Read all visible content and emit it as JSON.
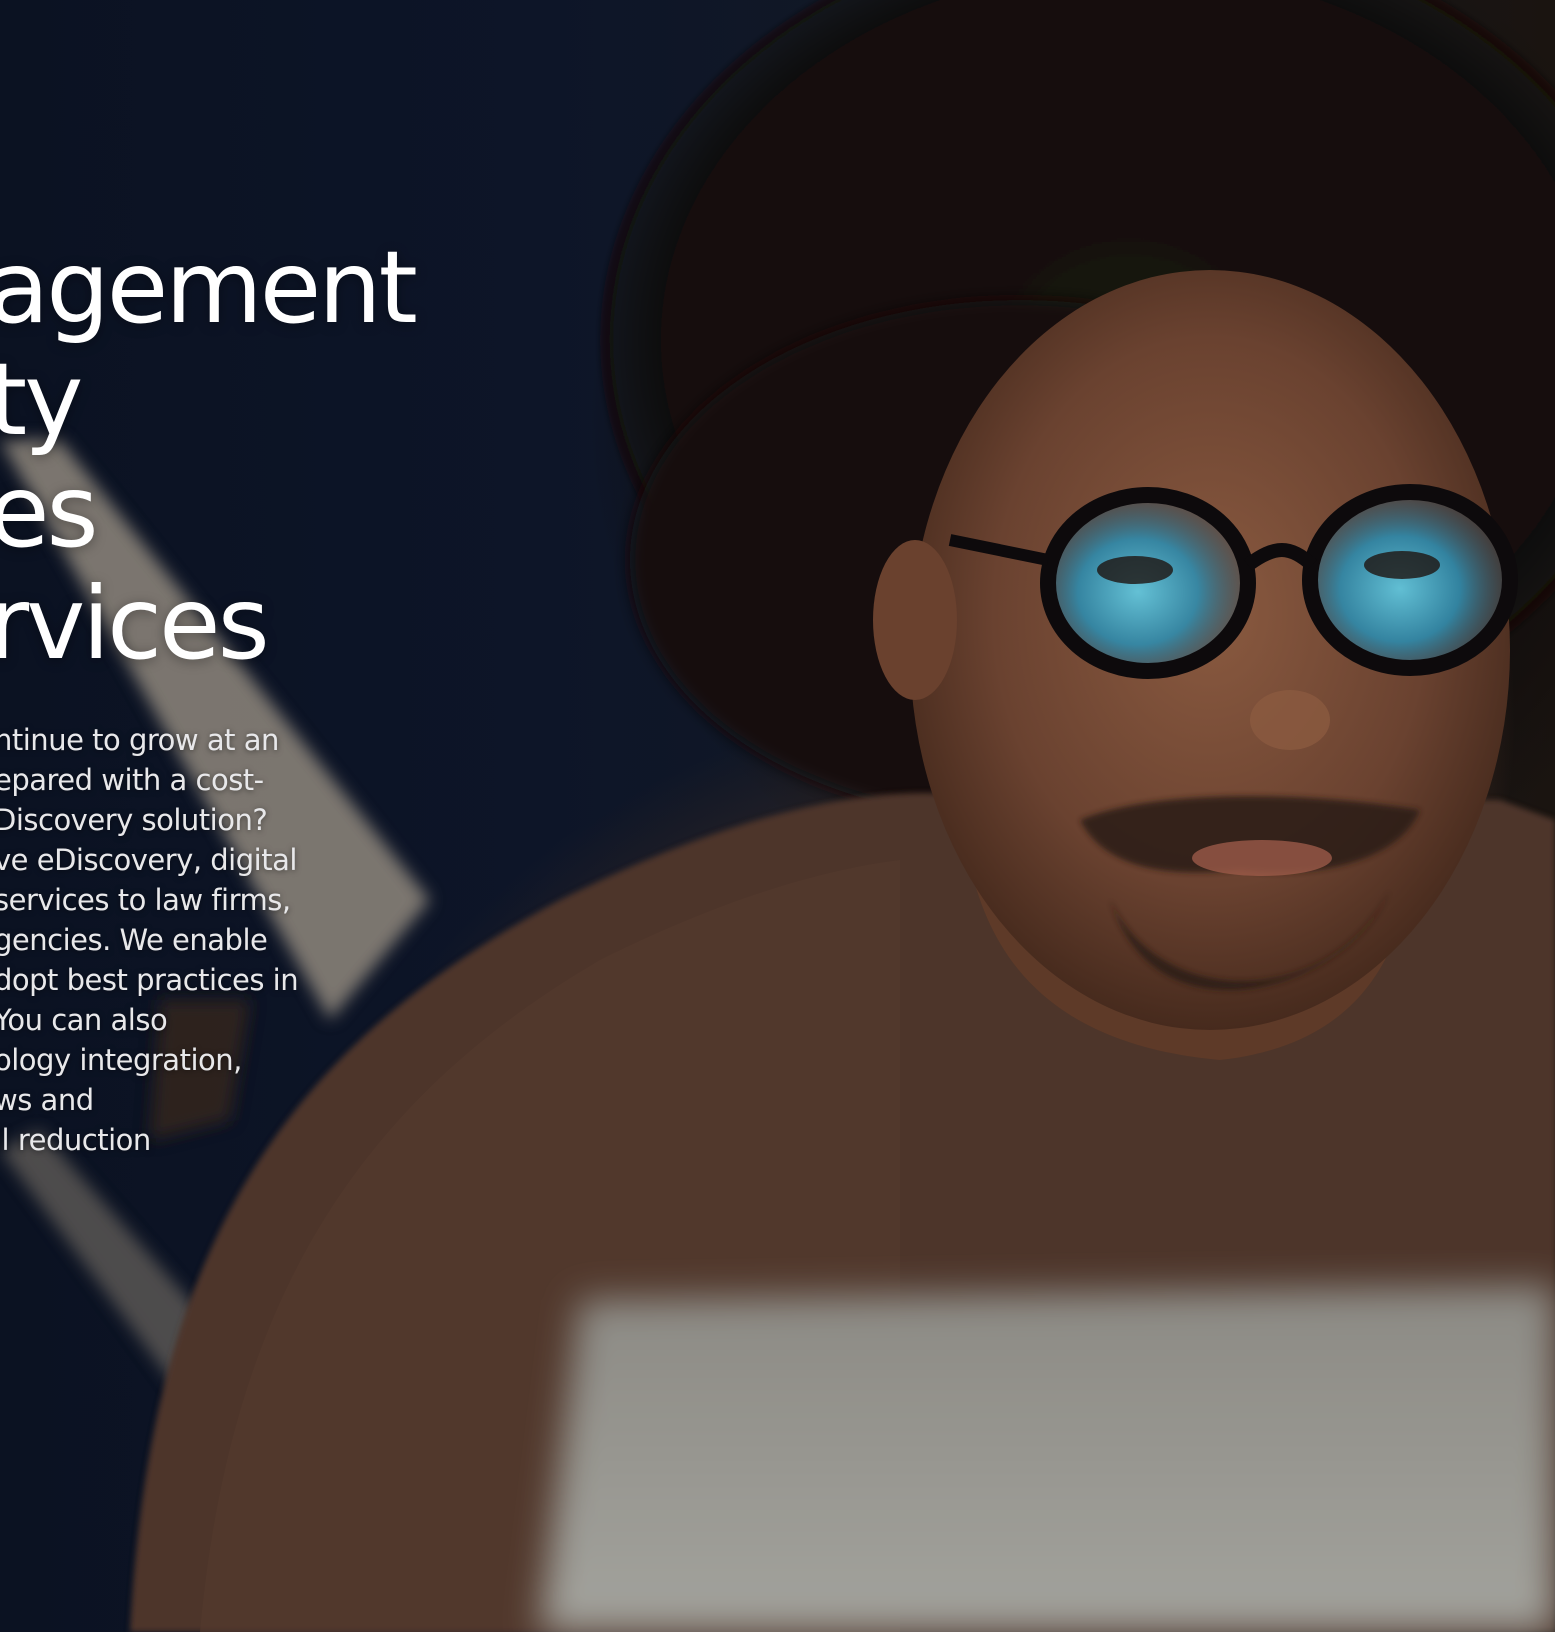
{
  "hero": {
    "title_lines": [
      "agement",
      "ty",
      "es",
      "rvices"
    ],
    "body_lines": [
      "ntinue to grow at an",
      "epared with a cost-",
      "Discovery solution?",
      "ve eDiscovery, digital",
      "services to law firms,",
      "gencies. We enable",
      "dopt best practices in",
      " You can also",
      "ology integration,",
      "ws and",
      "ll reduction"
    ]
  },
  "colors": {
    "background": "#0b1222",
    "title_text": "#ffffff",
    "body_text": "#e8e8ea"
  }
}
